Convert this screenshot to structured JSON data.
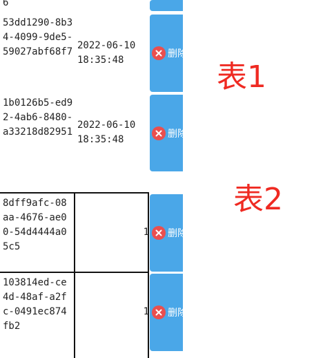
{
  "table1": {
    "partial_row_tail": "6",
    "rows": [
      {
        "id": "53dd1290-8b34-4099-9de5-59027abf68f7",
        "date": "2022-06-10 18:35:48",
        "delete_label": "删除"
      },
      {
        "id": "1b0126b5-ed92-4ab6-8480-a33218d82951",
        "date": "2022-06-10 18:35:48",
        "delete_label": "删除"
      }
    ]
  },
  "table2": {
    "rows": [
      {
        "id": "8dff9afc-08aa-4676-ae00-54d4444a05c5",
        "num": "1",
        "delete_label": "删除"
      },
      {
        "id": "103814ed-ce4d-48af-a2fc-0491ec874fb2",
        "num": "1",
        "delete_label": "删除"
      }
    ]
  },
  "annotations": {
    "label1": "表1",
    "label2": "表2"
  },
  "colors": {
    "button_blue": "#4aa7e8",
    "delete_icon_red": "#e94f4f",
    "annotation_red": "#ef2a22"
  }
}
